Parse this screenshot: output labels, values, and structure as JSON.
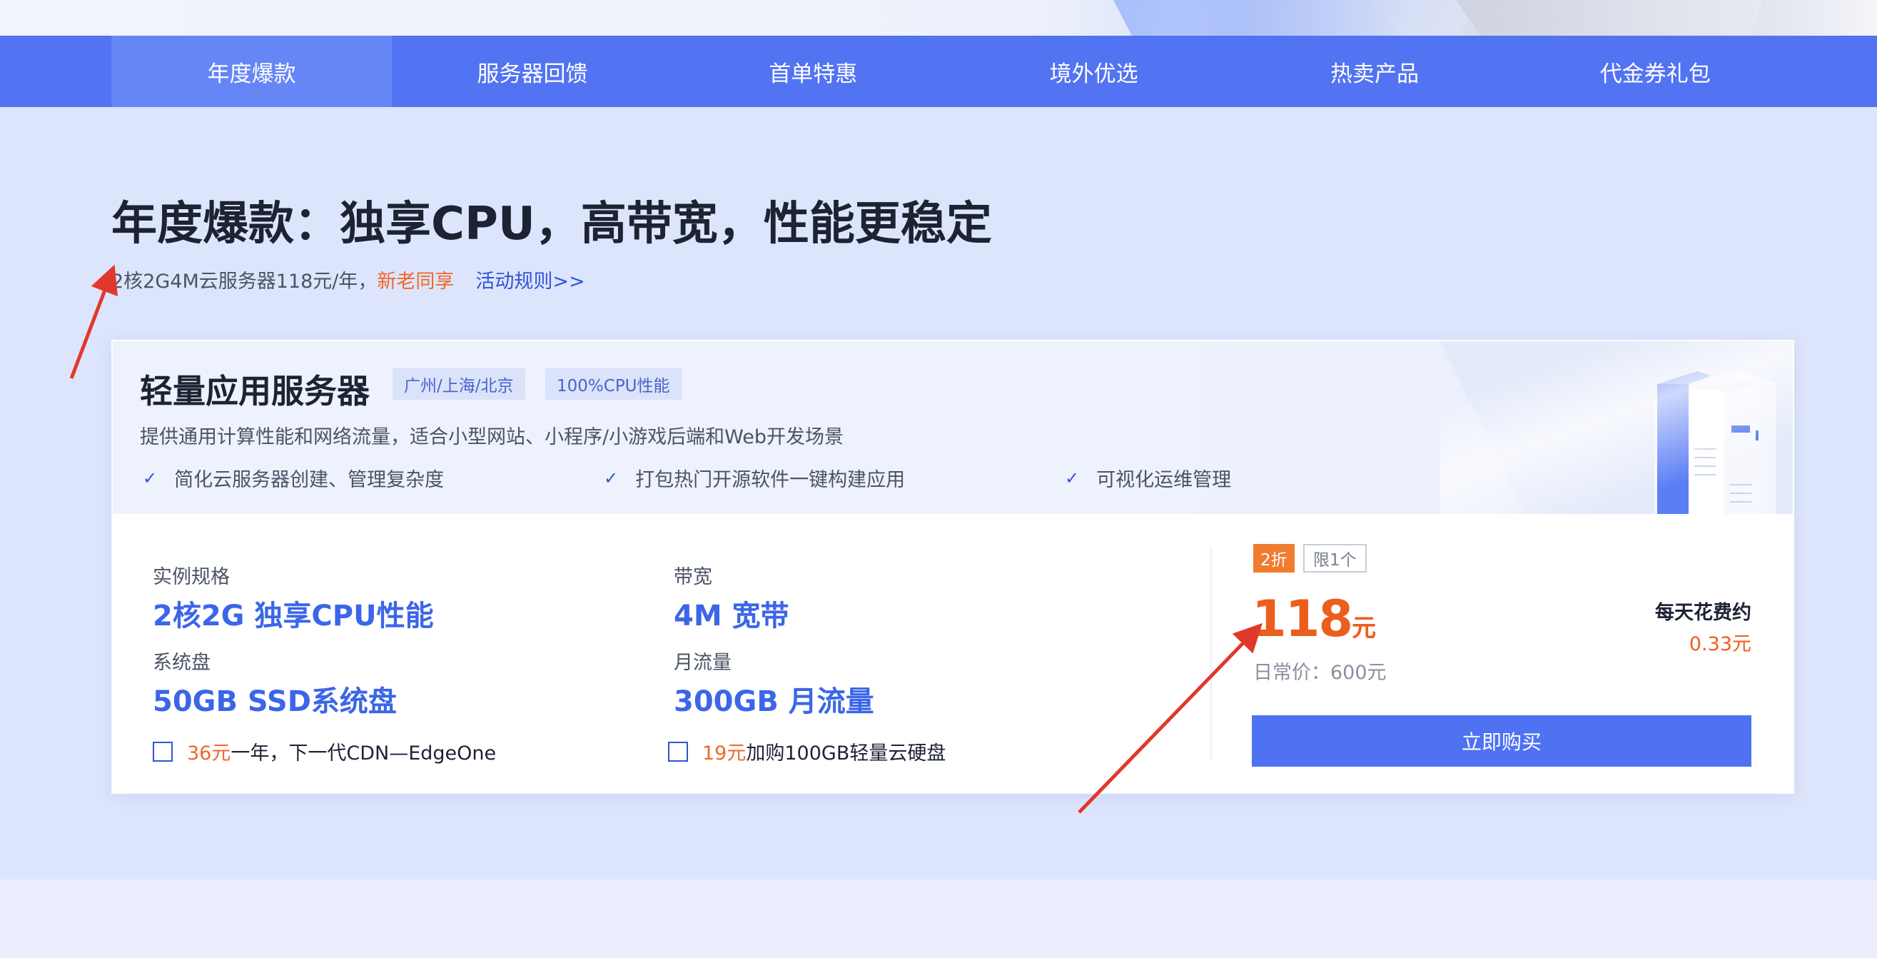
{
  "nav": {
    "tabs": [
      {
        "label": "年度爆款",
        "active": true
      },
      {
        "label": "服务器回馈",
        "active": false
      },
      {
        "label": "首单特惠",
        "active": false
      },
      {
        "label": "境外优选",
        "active": false
      },
      {
        "label": "热卖产品",
        "active": false
      },
      {
        "label": "代金券礼包",
        "active": false
      }
    ]
  },
  "section": {
    "title": "年度爆款：独享CPU，高带宽，性能更稳定",
    "subtitle": "2核2G4M云服务器118元/年，",
    "highlight": "新老同享",
    "rules_link": "活动规则>>"
  },
  "card": {
    "title": "轻量应用服务器",
    "tags": [
      "广州/上海/北京",
      "100%CPU性能"
    ],
    "description": "提供通用计算性能和网络流量，适合小型网站、小程序/小游戏后端和Web开发场景",
    "features": [
      "简化云服务器创建、管理复杂度",
      "打包热门开源软件一键构建应用",
      "可视化运维管理"
    ],
    "specs": {
      "instance_label": "实例规格",
      "instance_value": "2核2G 独享CPU性能",
      "bandwidth_label": "带宽",
      "bandwidth_value": "4M 宽带",
      "disk_label": "系统盘",
      "disk_value": "50GB SSD系统盘",
      "traffic_label": "月流量",
      "traffic_value": "300GB 月流量"
    },
    "addons": [
      {
        "price": "36元",
        "text": "一年，下一代CDN—EdgeOne",
        "checked": false
      },
      {
        "price": "19元",
        "text": "加购100GB轻量云硬盘",
        "checked": false
      }
    ],
    "pricing": {
      "discount_badge": "2折",
      "limit_badge": "限1个",
      "price": "118",
      "unit": "元",
      "original": "日常价：600元",
      "daily_label": "每天花费约",
      "daily_value": "0.33元",
      "buy_label": "立即购买"
    }
  },
  "colors": {
    "brand_blue": "#5273f2",
    "accent_orange": "#ec5e1c",
    "spec_blue": "#3b66e8",
    "annotation_red": "#e0392b"
  }
}
